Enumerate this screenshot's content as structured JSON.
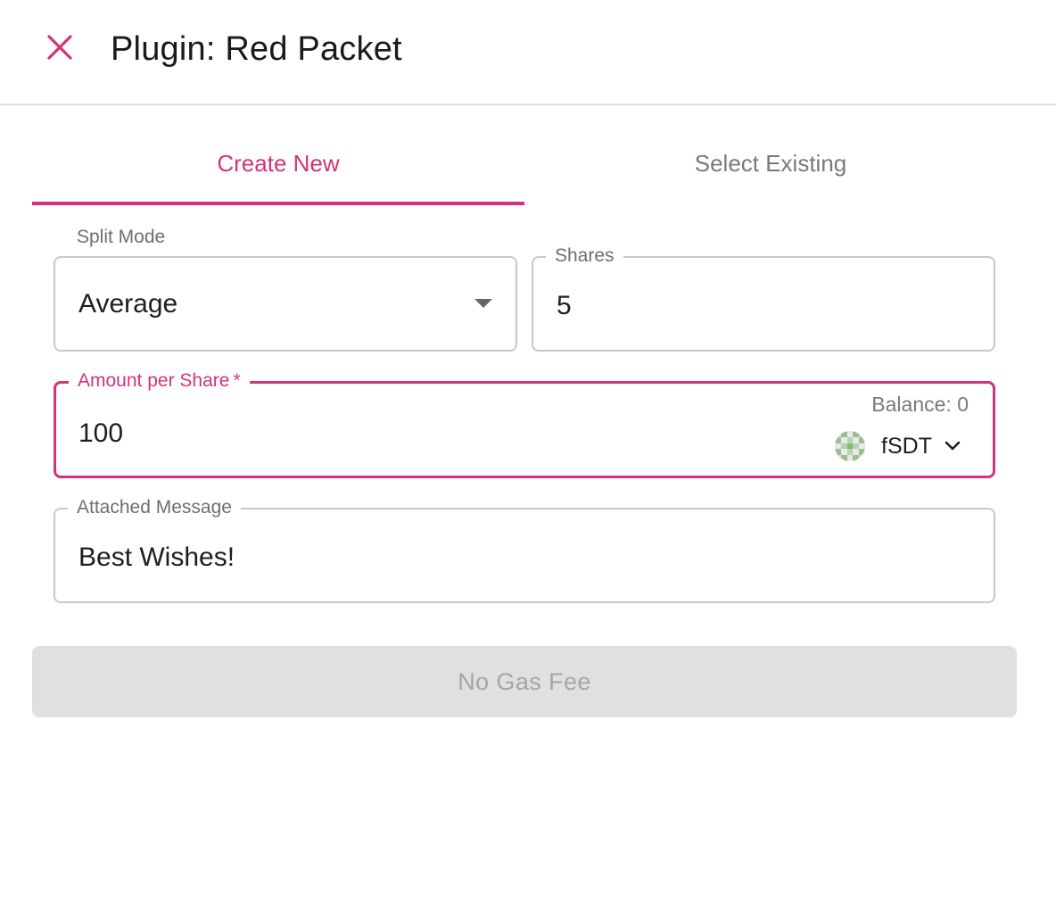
{
  "dialog": {
    "title": "Plugin: Red Packet"
  },
  "tabs": [
    {
      "label": "Create New",
      "active": true
    },
    {
      "label": "Select Existing",
      "active": false
    }
  ],
  "form": {
    "split_mode": {
      "label": "Split Mode",
      "value": "Average"
    },
    "shares": {
      "label": "Shares",
      "value": "5"
    },
    "amount": {
      "label": "Amount per Share",
      "required_mark": "*",
      "value": "100",
      "balance": "Balance: 0",
      "token_symbol": "fSDT"
    },
    "message": {
      "label": "Attached Message",
      "value": "Best Wishes!"
    }
  },
  "submit": {
    "label": "No Gas Fee",
    "disabled": true
  },
  "colors": {
    "accent": "#d4337a",
    "border": "#c8c8c8",
    "disabled_bg": "#e0e0e0",
    "disabled_text": "#a6a6a6"
  },
  "icons": {
    "close": "close-icon",
    "dropdown": "caret-down-icon",
    "token_menu": "chevron-down-icon",
    "token": "token-identicon"
  }
}
